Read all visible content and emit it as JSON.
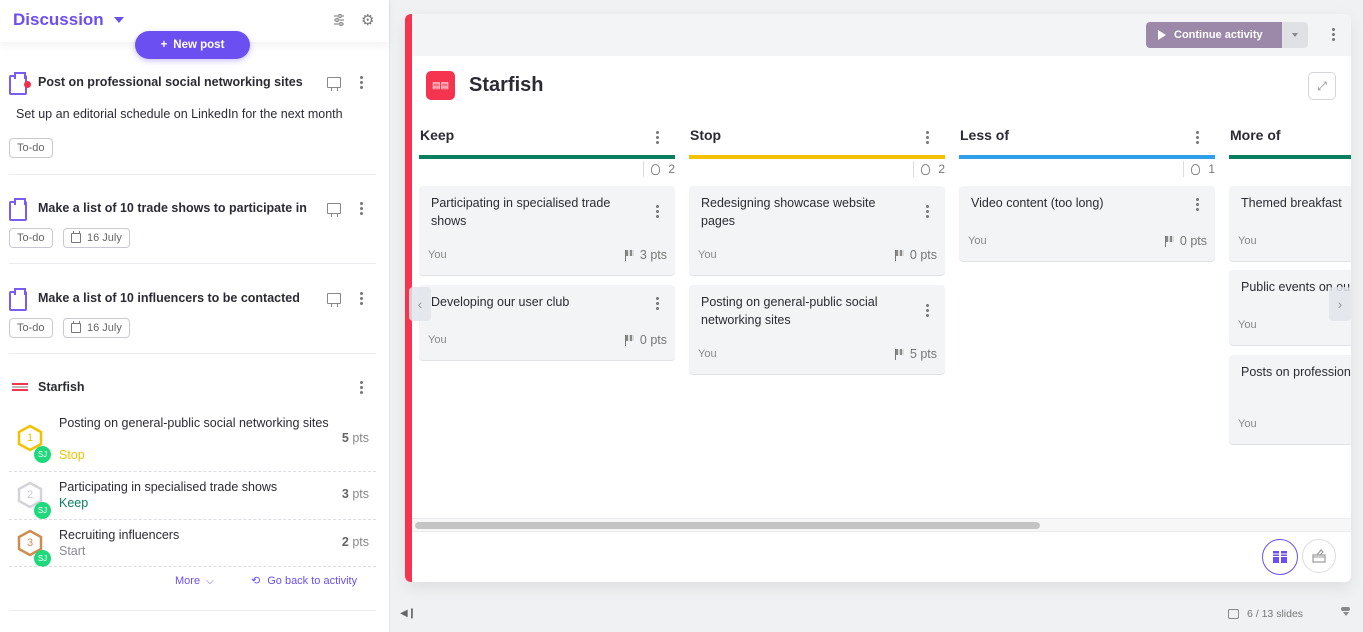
{
  "left_panel": {
    "title": "Discussion",
    "new_post_label": "New post",
    "posts": [
      {
        "title": "Post on professional social networking sites",
        "description": "Set up an editorial schedule on LinkedIn for the next month",
        "status": "To-do",
        "date": null,
        "has_notification": true
      },
      {
        "title": "Make a list of 10 trade shows to participate in",
        "status": "To-do",
        "date": "16 July"
      },
      {
        "title": "Make a list of 10 influencers to be contacted",
        "status": "To-do",
        "date": "16 July"
      }
    ],
    "activity_post": {
      "title": "Starfish",
      "rankings": [
        {
          "rank": "1",
          "text": "Posting on general-public social networking sites",
          "category": "Stop",
          "category_color": "#f2c200",
          "points": "5",
          "points_unit": "pts",
          "avatar": "SJ",
          "medal_color": "#f2c200"
        },
        {
          "rank": "2",
          "text": "Participating in specialised trade shows",
          "category": "Keep",
          "category_color": "#0a7f5f",
          "points": "3",
          "points_unit": "pts",
          "avatar": "SJ",
          "medal_color": "#c9c9cd"
        },
        {
          "rank": "3",
          "text": "Recruiting influencers",
          "category": "Start",
          "category_color": "#8a8a92",
          "points": "2",
          "points_unit": "pts",
          "avatar": "SJ",
          "medal_color": "#d08c4f"
        }
      ],
      "more_label": "More",
      "go_back_label": "Go back to activity"
    }
  },
  "main": {
    "continue_label": "Continue activity",
    "activity_title": "Starfish",
    "columns": [
      {
        "title": "Keep",
        "color": "#0a7f5f",
        "count": "2",
        "cards": [
          {
            "text": "Participating in specialised trade shows",
            "author": "You",
            "points": "3 pts"
          },
          {
            "text": "Developing our user club",
            "author": "You",
            "points": "0 pts"
          }
        ]
      },
      {
        "title": "Stop",
        "color": "#f2c200",
        "count": "2",
        "cards": [
          {
            "text": "Redesigning showcase website pages",
            "author": "You",
            "points": "0 pts"
          },
          {
            "text": "Posting on general-public social networking sites",
            "author": "You",
            "points": "5 pts"
          }
        ]
      },
      {
        "title": "Less of",
        "color": "#2e9fe8",
        "count": "1",
        "cards": [
          {
            "text": "Video content (too long)",
            "author": "You",
            "points": "0 pts"
          }
        ]
      },
      {
        "title": "More of",
        "color": "#0a7f5f",
        "count": "",
        "cards": [
          {
            "text": "Themed breakfast",
            "author": "You"
          },
          {
            "text": "Public events on our",
            "author": "You"
          },
          {
            "text": "Posts on professional networking sites",
            "author": "You"
          }
        ]
      }
    ],
    "slides": "6 / 13 slides"
  }
}
